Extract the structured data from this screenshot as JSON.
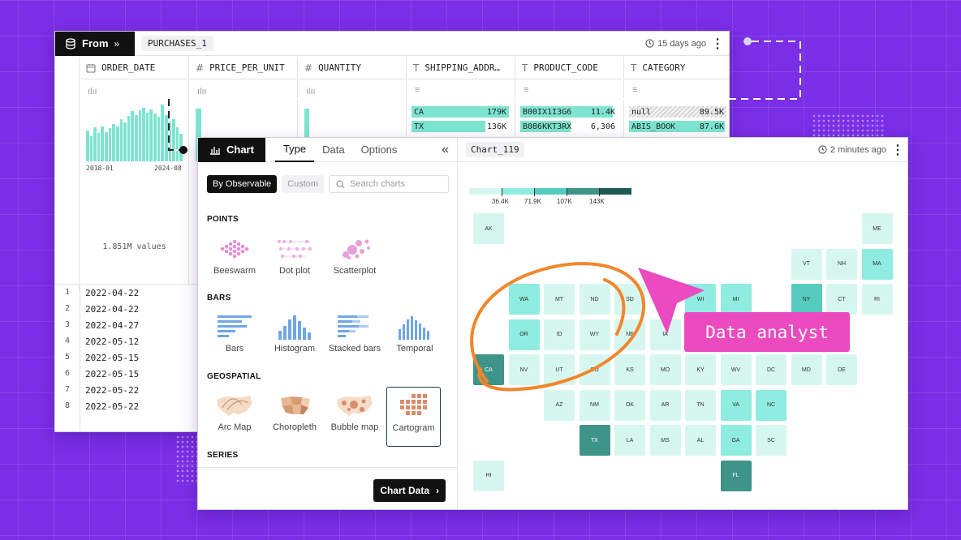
{
  "table": {
    "source_label": "From",
    "source_chevron": "»",
    "table_name": "PURCHASES_1",
    "updated": "15 days ago",
    "columns": [
      {
        "name": "ORDER_DATE",
        "type_icon": "calendar-icon"
      },
      {
        "name": "PRICE_PER_UNIT",
        "type_icon": "hash-icon"
      },
      {
        "name": "QUANTITY",
        "type_icon": "hash-icon"
      },
      {
        "name": "SHIPPING_ADDR…",
        "type_icon": "text-icon"
      },
      {
        "name": "PRODUCT_CODE",
        "type_icon": "text-icon"
      },
      {
        "name": "CATEGORY",
        "type_icon": "text-icon"
      }
    ],
    "order_date_axis": {
      "start": "2018-01",
      "end": "2024-08"
    },
    "order_date_hist": [
      0.55,
      0.45,
      0.6,
      0.5,
      0.62,
      0.52,
      0.58,
      0.66,
      0.62,
      0.75,
      0.68,
      0.8,
      0.88,
      0.82,
      0.9,
      0.95,
      0.86,
      0.92,
      0.85,
      0.78,
      1.0,
      0.82,
      0.7,
      0.74,
      0.6,
      0.48
    ],
    "order_date_count": "1.851M values",
    "shipping_top": [
      {
        "label": "CA",
        "value": "179K",
        "frac": 1.0
      },
      {
        "label": "TX",
        "value": "136K",
        "frac": 0.76
      }
    ],
    "product_top": [
      {
        "label": "B00IX1I3G6",
        "value": "11.4K",
        "frac": 0.95
      },
      {
        "label": "B086KKT3RX",
        "value": "6,306",
        "frac": 0.5
      }
    ],
    "category_top": [
      {
        "label": "null",
        "value": "89.5K",
        "frac": 1.0,
        "null": true
      },
      {
        "label": "ABIS_BOOK",
        "value": "87.6K",
        "frac": 0.98
      }
    ],
    "rows": [
      {
        "n": "1",
        "date": "2022-04-22"
      },
      {
        "n": "2",
        "date": "2022-04-22"
      },
      {
        "n": "3",
        "date": "2022-04-27"
      },
      {
        "n": "4",
        "date": "2022-05-12"
      },
      {
        "n": "5",
        "date": "2022-05-15"
      },
      {
        "n": "6",
        "date": "2022-05-15"
      },
      {
        "n": "7",
        "date": "2022-05-22"
      },
      {
        "n": "8",
        "date": "2022-05-22"
      }
    ]
  },
  "chart_panel": {
    "tab_label": "Chart",
    "tabs": [
      "Type",
      "Data",
      "Options"
    ],
    "active_tab": "Type",
    "collapse_icon": "«",
    "filter_active": "By Observable",
    "filter_inactive": "Custom",
    "search_placeholder": "Search charts",
    "sections": [
      {
        "title": "POINTS",
        "items": [
          "Beeswarm",
          "Dot plot",
          "Scatterplot"
        ]
      },
      {
        "title": "BARS",
        "items": [
          "Bars",
          "Histogram",
          "Stacked bars",
          "Temporal"
        ]
      },
      {
        "title": "GEOSPATIAL",
        "items": [
          "Arc Map",
          "Choropleth",
          "Bubble map",
          "Cartogram"
        ]
      },
      {
        "title": "SERIES",
        "items": []
      }
    ],
    "selected_type": "Cartogram",
    "chart_data_button": "Chart Data",
    "chart_name": "Chart_119",
    "chart_updated": "2 minutes ago"
  },
  "annotation_tag": "Data analyst",
  "colors": {
    "background": "#7a2ee6",
    "teal": "#7de4cf",
    "pink": "#ec4bbf",
    "orange": "#f2862c"
  },
  "chart_data": {
    "type": "heatmap",
    "subtype": "state tile cartogram",
    "legend_thresholds": [
      "36.4K",
      "71.9K",
      "107K",
      "143K"
    ],
    "legend_colors": [
      "#d6f7ef",
      "#8fece0",
      "#57cbbd",
      "#3e9488",
      "#1f5a52"
    ],
    "states": [
      {
        "code": "AK",
        "bin": 0
      },
      {
        "code": "ME",
        "bin": 0
      },
      {
        "code": "VT",
        "bin": 0
      },
      {
        "code": "NH",
        "bin": 0
      },
      {
        "code": "MA",
        "bin": 1
      },
      {
        "code": "WA",
        "bin": 1
      },
      {
        "code": "MT",
        "bin": 0
      },
      {
        "code": "ND",
        "bin": 0
      },
      {
        "code": "SD",
        "bin": 0
      },
      {
        "code": "WI",
        "bin": 1
      },
      {
        "code": "MI",
        "bin": 1
      },
      {
        "code": "NY",
        "bin": 2
      },
      {
        "code": "CT",
        "bin": 0
      },
      {
        "code": "RI",
        "bin": 0
      },
      {
        "code": "OR",
        "bin": 1
      },
      {
        "code": "ID",
        "bin": 0
      },
      {
        "code": "WY",
        "bin": 0
      },
      {
        "code": "NE",
        "bin": 0
      },
      {
        "code": "IA",
        "bin": 0
      },
      {
        "code": "CA",
        "bin": 3
      },
      {
        "code": "NV",
        "bin": 0
      },
      {
        "code": "UT",
        "bin": 0
      },
      {
        "code": "CO",
        "bin": 0
      },
      {
        "code": "KS",
        "bin": 0
      },
      {
        "code": "MO",
        "bin": 0
      },
      {
        "code": "KY",
        "bin": 0
      },
      {
        "code": "WV",
        "bin": 0
      },
      {
        "code": "DC",
        "bin": 0
      },
      {
        "code": "MD",
        "bin": 0
      },
      {
        "code": "DE",
        "bin": 0
      },
      {
        "code": "AZ",
        "bin": 0
      },
      {
        "code": "NM",
        "bin": 0
      },
      {
        "code": "OK",
        "bin": 0
      },
      {
        "code": "AR",
        "bin": 0
      },
      {
        "code": "TN",
        "bin": 0
      },
      {
        "code": "VA",
        "bin": 1
      },
      {
        "code": "NC",
        "bin": 1
      },
      {
        "code": "TX",
        "bin": 3
      },
      {
        "code": "LA",
        "bin": 0
      },
      {
        "code": "MS",
        "bin": 0
      },
      {
        "code": "AL",
        "bin": 0
      },
      {
        "code": "GA",
        "bin": 1
      },
      {
        "code": "SC",
        "bin": 0
      },
      {
        "code": "HI",
        "bin": 0
      },
      {
        "code": "FL",
        "bin": 3
      }
    ]
  }
}
